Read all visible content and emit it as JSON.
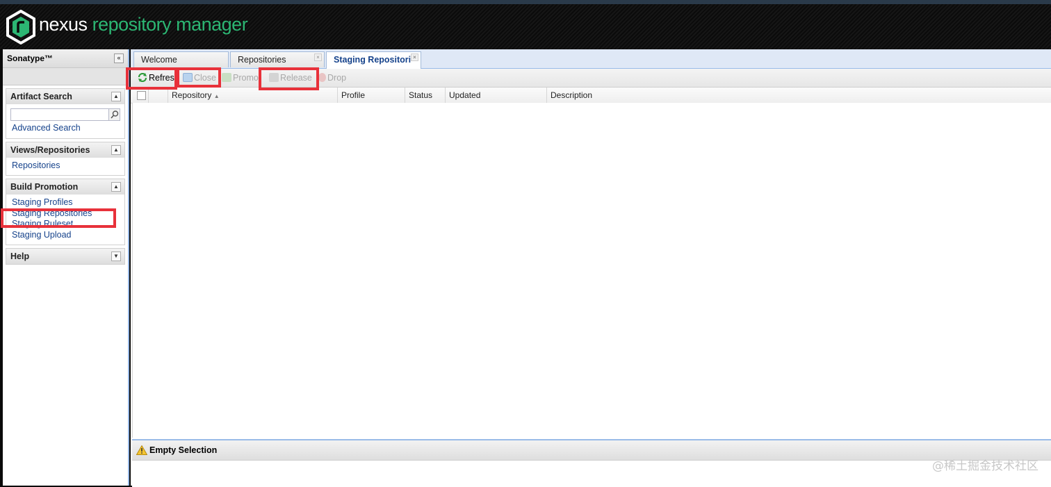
{
  "header": {
    "brand_part1": "nexus",
    "brand_part2": "repository manager",
    "brand_color": "#2cb673"
  },
  "left_panel": {
    "title": "Sonatype™",
    "collapse_glyph": "«",
    "sections": {
      "artifact_search": {
        "title": "Artifact Search",
        "search_placeholder": "",
        "advanced_link": "Advanced Search"
      },
      "views": {
        "title": "Views/Repositories",
        "items": [
          "Repositories"
        ]
      },
      "build_promotion": {
        "title": "Build Promotion",
        "items": [
          "Staging Profiles",
          "Staging Repositories",
          "Staging Ruleset",
          "Staging Upload"
        ]
      },
      "help": {
        "title": "Help"
      }
    }
  },
  "tabs": [
    {
      "label": "Welcome",
      "closable": false,
      "active": false
    },
    {
      "label": "Repositories",
      "closable": true,
      "active": false
    },
    {
      "label": "Staging Repositori",
      "closable": true,
      "active": true
    }
  ],
  "toolbar": {
    "refresh": "Refres",
    "close": "Close",
    "promote": "Promot",
    "release": "Release",
    "drop": "Drop"
  },
  "grid": {
    "columns": [
      "Repository",
      "Profile",
      "Status",
      "Updated",
      "Description"
    ],
    "sort_indicator": "▲",
    "rows": []
  },
  "bottom_panel": {
    "title": "Empty Selection"
  },
  "watermark": "@稀土掘金技术社区",
  "highlight_color": "#e8313a"
}
